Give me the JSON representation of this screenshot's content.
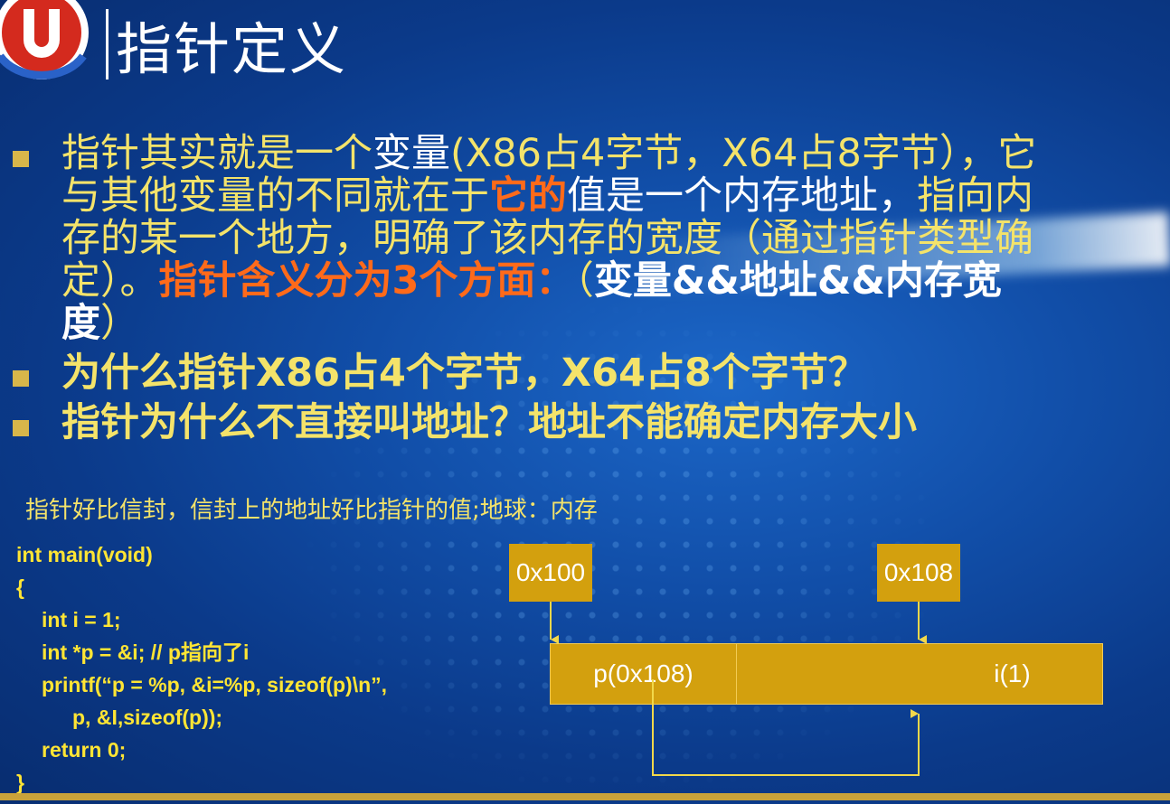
{
  "slide": {
    "title": "指针定义",
    "bullets": [
      {
        "segments": [
          "指针其实就是一个",
          "变量",
          "(X86占4字节，X64占8字节），它与其他变量的不同就在于",
          "它的",
          "值是一个内存地址，",
          "指向内存的某一个地方，明确了该内存的宽度（通过指针类型确定）。",
          "指针含义分为3个方面：",
          "（",
          "变量&&地址&&内存宽度",
          "）"
        ]
      },
      {
        "text": "为什么指针X86占4个字节，X64占8个字节？"
      },
      {
        "text": "指针为什么不直接叫地址？地址不能确定内存大小"
      }
    ],
    "analogy": "指针好比信封，信封上的地址好比指针的值;地球：内存"
  },
  "code": [
    "int main(void)",
    "{",
    "int i = 1;",
    "int *p = &i; // p指向了i",
    "printf(“p = %p, &i=%p, sizeof(p)\\n”,",
    "p, &I,sizeof(p));",
    "return 0;",
    "}"
  ],
  "diagram": {
    "addresses": [
      "0x100",
      "0x108"
    ],
    "cells": [
      "p(0x108)",
      "i(1)"
    ]
  },
  "colors": {
    "background": "#0b3a8a",
    "bullet_text": "#f4e36a",
    "highlight": "#ff6a1a",
    "code_text": "#ffe534",
    "box_fill": "#d3a00e"
  }
}
